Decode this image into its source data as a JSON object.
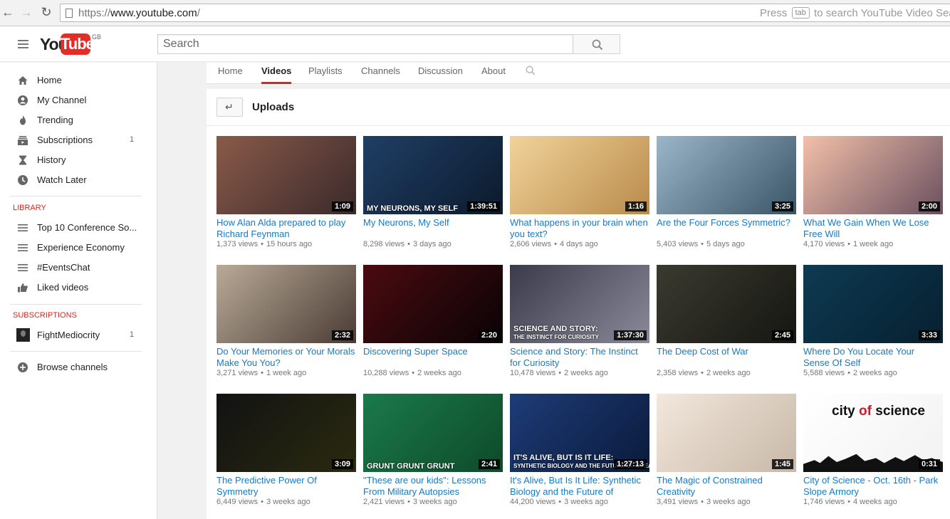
{
  "browser": {
    "url_proto": "https://",
    "url_host": "www.youtube.com",
    "url_path": "/",
    "hint_pre": "Press",
    "hint_key": "tab",
    "hint_post": "to search YouTube Video Sear"
  },
  "header": {
    "logo_you": "You",
    "logo_tube": "Tube",
    "logo_region": "GB",
    "search_placeholder": "Search"
  },
  "sidebar": {
    "items": [
      {
        "label": "Home",
        "icon": "home-icon"
      },
      {
        "label": "My Channel",
        "icon": "person-icon"
      },
      {
        "label": "Trending",
        "icon": "flame-icon"
      },
      {
        "label": "Subscriptions",
        "icon": "subscriptions-icon",
        "count": "1"
      },
      {
        "label": "History",
        "icon": "hourglass-icon"
      },
      {
        "label": "Watch Later",
        "icon": "clock-icon"
      }
    ],
    "library_heading": "LIBRARY",
    "library": [
      {
        "label": "Top 10 Conference So...",
        "icon": "playlist-icon"
      },
      {
        "label": "Experience Economy",
        "icon": "playlist-icon"
      },
      {
        "label": "#EventsChat",
        "icon": "playlist-icon"
      },
      {
        "label": "Liked videos",
        "icon": "thumbs-up-icon"
      }
    ],
    "subscriptions_heading": "SUBSCRIPTIONS",
    "subscriptions": [
      {
        "label": "FightMediocrity",
        "count": "1"
      }
    ],
    "browse_channels": "Browse channels"
  },
  "tabs": [
    "Home",
    "Videos",
    "Playlists",
    "Channels",
    "Discussion",
    "About"
  ],
  "active_tab": "Videos",
  "uploads_title": "Uploads",
  "videos": [
    {
      "title": "How Alan Alda prepared to play Richard Feynman",
      "views": "1,373 views",
      "age": "15 hours ago",
      "duration": "1:09",
      "overlay": ""
    },
    {
      "title": "My Neurons, My Self",
      "views": "8,298 views",
      "age": "3 days ago",
      "duration": "1:39:51",
      "overlay": "MY NEURONS, MY SELF"
    },
    {
      "title": "What happens in your brain when you text?",
      "views": "2,606 views",
      "age": "4 days ago",
      "duration": "1:16",
      "overlay": ""
    },
    {
      "title": "Are the Four Forces Symmetric?",
      "views": "5,403 views",
      "age": "5 days ago",
      "duration": "3:25",
      "overlay": ""
    },
    {
      "title": "What We Gain When We Lose Free Will",
      "views": "4,170 views",
      "age": "1 week ago",
      "duration": "2:00",
      "overlay": ""
    },
    {
      "title": "Do Your Memories or Your Morals Make You You?",
      "views": "3,271 views",
      "age": "1 week ago",
      "duration": "2:32",
      "overlay": ""
    },
    {
      "title": "Discovering Super Space",
      "views": "10,288 views",
      "age": "2 weeks ago",
      "duration": "2:20",
      "overlay": ""
    },
    {
      "title": "Science and Story: The Instinct for Curiosity",
      "views": "10,478 views",
      "age": "2 weeks ago",
      "duration": "1:37:30",
      "overlay": "SCIENCE AND STORY:",
      "overlay2": "THE INSTINCT FOR CURIOSITY"
    },
    {
      "title": "The Deep Cost of War",
      "views": "2,358 views",
      "age": "2 weeks ago",
      "duration": "2:45",
      "overlay": ""
    },
    {
      "title": "Where Do You Locate Your Sense Of Self",
      "views": "5,588 views",
      "age": "2 weeks ago",
      "duration": "3:33",
      "overlay": ""
    },
    {
      "title": "The Predictive Power Of Symmetry",
      "views": "6,449 views",
      "age": "3 weeks ago",
      "duration": "3:09",
      "overlay": ""
    },
    {
      "title": "\"These are our kids\": Lessons From Military Autopsies",
      "views": "2,421 views",
      "age": "3 weeks ago",
      "duration": "2:41",
      "overlay": "GRUNT  GRUNT  GRUNT"
    },
    {
      "title": "It's Alive, But Is It Life: Synthetic Biology and the Future of",
      "views": "44,200 views",
      "age": "3 weeks ago",
      "duration": "1:27:13",
      "overlay": "IT'S ALIVE, BUT IS IT LIFE:",
      "overlay2": "SYNTHETIC BIOLOGY AND THE FUTURE OF CREAT"
    },
    {
      "title": "The Magic of Constrained Creativity",
      "views": "3,491 views",
      "age": "3 weeks ago",
      "duration": "1:45",
      "overlay": ""
    },
    {
      "title": "City of Science - Oct. 16th - Park Slope Armory",
      "views": "1,746 views",
      "age": "4 weeks ago",
      "duration": "0:31",
      "overlay": "",
      "logo_city": "city",
      "logo_of": "of",
      "logo_science": "science"
    }
  ],
  "thumb_colors": [
    [
      "#8a5a4a",
      "#3a2a2a"
    ],
    [
      "#1f3f66",
      "#0c1a2c"
    ],
    [
      "#f1d39a",
      "#b98a4a"
    ],
    [
      "#9ab6c8",
      "#3a5566"
    ],
    [
      "#f3c0a8",
      "#6a5060"
    ],
    [
      "#b9aa98",
      "#4a3c34"
    ],
    [
      "#4a0b10",
      "#090305"
    ],
    [
      "#3a3a4a",
      "#8a8a9a"
    ],
    [
      "#3a3a30",
      "#161612"
    ],
    [
      "#0e3a52",
      "#062030"
    ],
    [
      "#121212",
      "#2a2a10"
    ],
    [
      "#1a7a4a",
      "#0e4a2a"
    ],
    [
      "#1e3c78",
      "#0a1a3a"
    ],
    [
      "#f2e8dc",
      "#c8b8a8"
    ],
    [
      "#ffffff",
      "#f2f2f2"
    ]
  ]
}
